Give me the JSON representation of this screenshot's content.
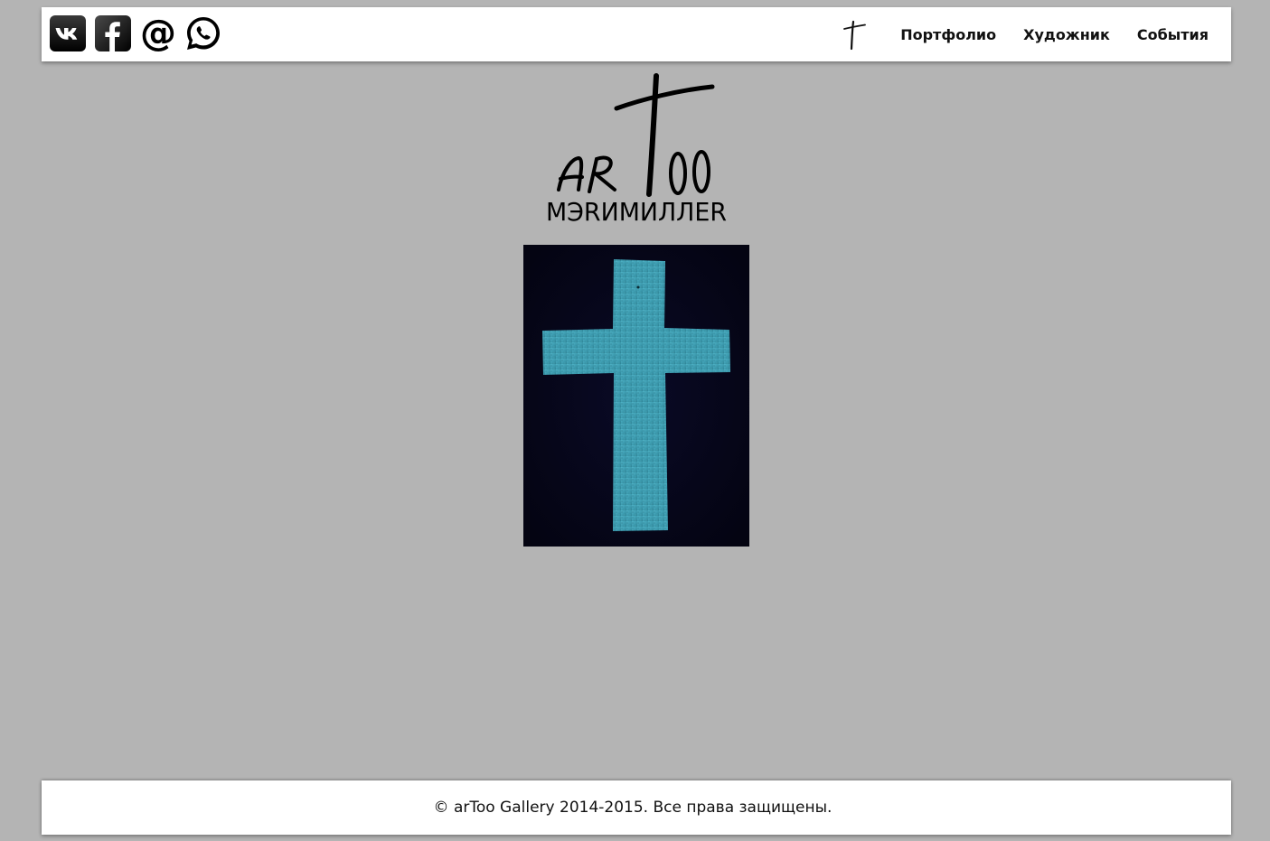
{
  "header": {
    "social": [
      {
        "name": "vk",
        "icon": "vk-icon"
      },
      {
        "name": "facebook",
        "icon": "facebook-icon"
      },
      {
        "name": "email",
        "icon": "at-sign-icon"
      },
      {
        "name": "whatsapp",
        "icon": "whatsapp-icon"
      }
    ],
    "cross_icon": "cross-mark-icon",
    "nav": {
      "portfolio": "Портфолио",
      "artist": "Художник",
      "events": "События"
    }
  },
  "logo": {
    "brand": "arToo",
    "artist_name": "МЭRИМИЛЛЕR"
  },
  "artwork": {
    "subject": "cross-painting",
    "colors": {
      "background": "#06061a",
      "cross": "#3f9eb3"
    }
  },
  "footer": {
    "copyright": "© arToo Gallery 2014-2015. Все права защищены."
  },
  "colors": {
    "page_background": "#b4b4b4",
    "bar_background": "#ffffff",
    "text": "#111111"
  }
}
